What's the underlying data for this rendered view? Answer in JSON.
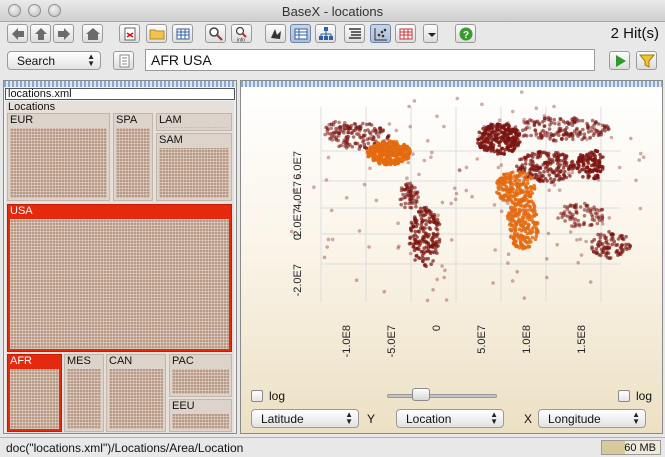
{
  "window": {
    "title": "BaseX - locations",
    "hits": "2 Hit(s)"
  },
  "toolbar": {
    "buttons": [
      {
        "name": "back-button",
        "icon": "arrow-left-icon"
      },
      {
        "name": "up-button",
        "icon": "arrow-up-icon"
      },
      {
        "name": "forward-button",
        "icon": "arrow-right-icon"
      },
      {
        "name": "home-button",
        "icon": "home-icon"
      },
      {
        "name": "new-button",
        "icon": "new-document-icon"
      },
      {
        "name": "open-button",
        "icon": "folder-icon"
      },
      {
        "name": "properties-button",
        "icon": "database-icon"
      },
      {
        "name": "find-button",
        "icon": "magnifier-icon"
      },
      {
        "name": "info-button",
        "icon": "magnifier-info-icon",
        "caption": "info"
      },
      {
        "name": "map-view-button",
        "icon": "map-icon"
      },
      {
        "name": "table-view-button",
        "icon": "table-icon"
      },
      {
        "name": "tree-view-button",
        "icon": "tree-icon"
      },
      {
        "name": "folder-view-button",
        "icon": "list-icon"
      },
      {
        "name": "plot-view-button",
        "icon": "scatter-plot-icon"
      },
      {
        "name": "text-view-button",
        "icon": "grid-icon"
      },
      {
        "name": "views-menu-button",
        "icon": "dropdown-icon"
      },
      {
        "name": "help-button",
        "icon": "help-icon"
      }
    ]
  },
  "search": {
    "mode": "Search",
    "query": "AFR USA"
  },
  "treemap": {
    "root": "locations.xml",
    "locations": "Locations",
    "regions": [
      "EUR",
      "SPA",
      "LAM",
      "SAM",
      "USA",
      "AFR",
      "MES",
      "CAN",
      "PAC",
      "EEU"
    ]
  },
  "plot": {
    "y_ticks": [
      "6.0E7",
      "4.0E7",
      "2.0E7",
      "0",
      "-2.0E7"
    ],
    "x_ticks": [
      "-1.0E8",
      "-5.0E7",
      "0",
      "5.0E7",
      "1.0E8",
      "1.5E8"
    ],
    "colors": {
      "default": "#7a1410",
      "highlight": "#e46a10"
    },
    "log_label": "log",
    "y_axis": "Latitude",
    "y_letter": "Y",
    "items": "Location",
    "x_letter": "X",
    "x_axis": "Longitude"
  },
  "status": {
    "path": "doc(\"locations.xml\")/Locations/Area/Location",
    "memory": "60 MB"
  }
}
